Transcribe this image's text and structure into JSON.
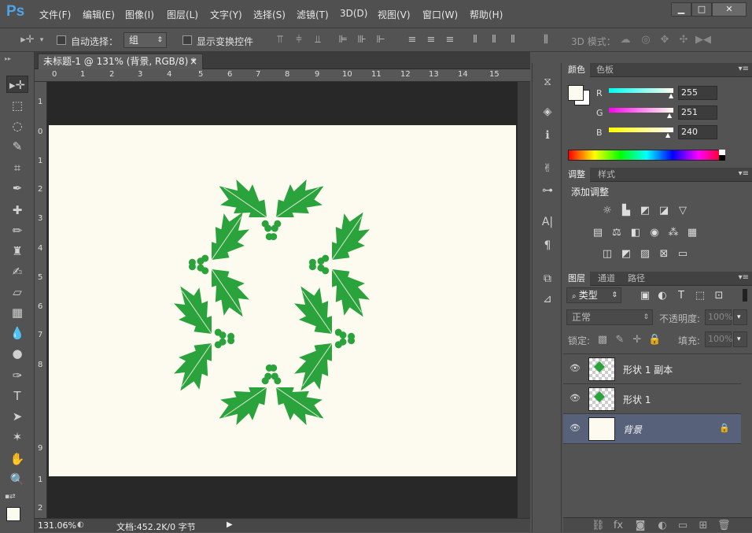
{
  "app": {
    "logo": "Ps"
  },
  "menu": [
    "文件(F)",
    "编辑(E)",
    "图像(I)",
    "图层(L)",
    "文字(Y)",
    "选择(S)",
    "滤镜(T)",
    "3D(D)",
    "视图(V)",
    "窗口(W)",
    "帮助(H)"
  ],
  "window_controls": {
    "minimize": "▁",
    "restore": "□",
    "close": "✕"
  },
  "options": {
    "auto_select_label": "自动选择：",
    "auto_select_value": "组",
    "show_transform_label": "显示变换控件",
    "mode_3d_label": "3D 模式："
  },
  "document": {
    "tab_title": "未标题-1 @ 131% (背景, RGB/8) *",
    "tab_close": "×",
    "zoom": "131.06%",
    "doc_info": "文档:452.2K/0 字节",
    "ruler_top": [
      "0",
      "1",
      "2",
      "3",
      "4",
      "5",
      "6",
      "7",
      "8",
      "9",
      "10",
      "11",
      "12",
      "13",
      "14",
      "15"
    ],
    "ruler_left": [
      "1",
      "0",
      "1",
      "2",
      "3",
      "4",
      "5",
      "6",
      "7",
      "8",
      "9",
      "1",
      "2"
    ]
  },
  "color_panel": {
    "tabs": [
      "颜色",
      "色板"
    ],
    "channels": [
      {
        "label": "R",
        "value": "255"
      },
      {
        "label": "G",
        "value": "251"
      },
      {
        "label": "B",
        "value": "240"
      }
    ],
    "foreground": "#fdfaf0"
  },
  "adjust_panel": {
    "tabs": [
      "调整",
      "样式"
    ],
    "title": "添加调整"
  },
  "layers_panel": {
    "tabs": [
      "图层",
      "通道",
      "路径"
    ],
    "filter_type": "类型",
    "blend_mode": "正常",
    "opacity_label": "不透明度:",
    "opacity_value": "100%",
    "lock_label": "锁定:",
    "fill_label": "填充:",
    "fill_value": "100%",
    "layers": [
      {
        "name": "形状 1 副本"
      },
      {
        "name": "形状 1"
      },
      {
        "name": "背景"
      }
    ]
  },
  "colors": {
    "holly": "#2aa33c",
    "canvas": "#fdfaf0",
    "selected_layer": "#57627a"
  }
}
